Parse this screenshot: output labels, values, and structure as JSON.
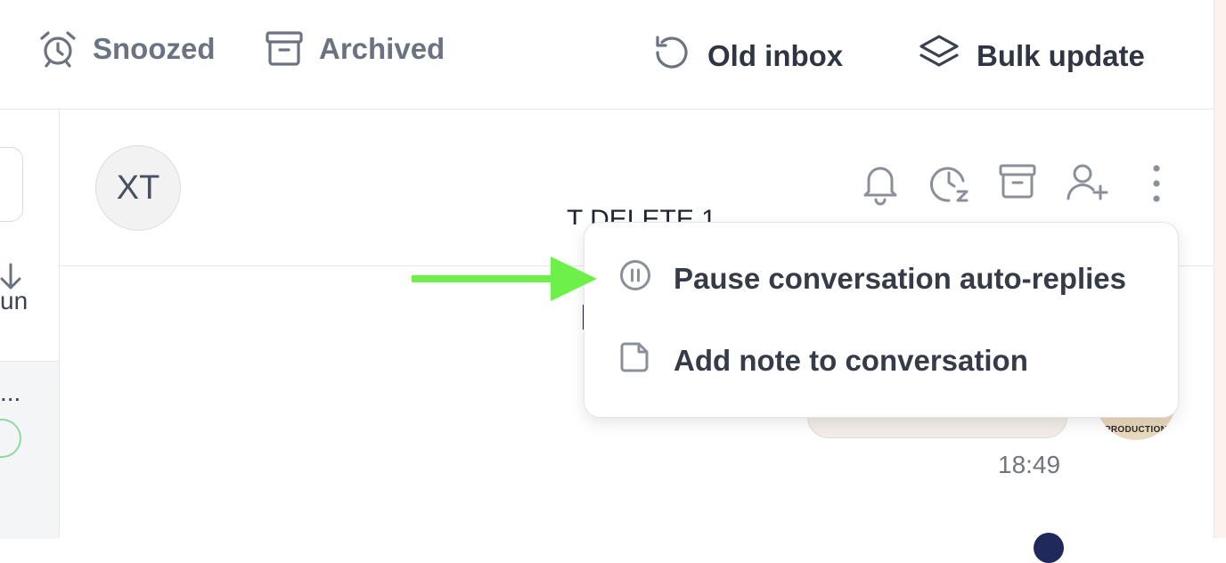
{
  "topbar": {
    "tabs": [
      {
        "label": "Snoozed",
        "icon": "alarm-clock-icon"
      },
      {
        "label": "Archived",
        "icon": "archive-box-icon"
      }
    ],
    "actions": [
      {
        "label": "Old inbox",
        "icon": "history-icon"
      },
      {
        "label": "Bulk update",
        "icon": "layers-icon"
      }
    ]
  },
  "left_panel": {
    "item_text_1": "un",
    "item_text_2": "..."
  },
  "conversation": {
    "avatar_initials": "XT",
    "title_fragment": "T DELETE 1",
    "header_icons": [
      "bell-icon",
      "snooze-clock-icon",
      "archive-icon",
      "add-user-icon",
      "more-vertical-icon"
    ],
    "message_time": "18:49",
    "sender_avatar_label": "PRODUCTION"
  },
  "menu": {
    "items": [
      {
        "label": "Pause conversation auto-replies",
        "icon": "pause-circle-icon"
      },
      {
        "label": "Add note to conversation",
        "icon": "note-icon"
      }
    ]
  },
  "annotation": {
    "arrow_color": "#6ef04a",
    "arrow_icon": "green-arrow-icon"
  }
}
